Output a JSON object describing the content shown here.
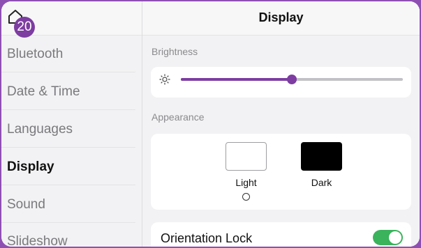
{
  "badge": "20",
  "sidebar": {
    "items": [
      {
        "label": "Bluetooth"
      },
      {
        "label": "Date & Time"
      },
      {
        "label": "Languages"
      },
      {
        "label": "Display"
      },
      {
        "label": "Sound"
      },
      {
        "label": "Slideshow"
      }
    ],
    "selected": "Display"
  },
  "main": {
    "title": "Display",
    "brightness": {
      "label": "Brightness",
      "value": 0.5
    },
    "appearance": {
      "label": "Appearance",
      "options": [
        {
          "label": "Light",
          "selected": false
        },
        {
          "label": "Dark",
          "selected": false
        }
      ]
    },
    "orientation_lock": {
      "label": "Orientation Lock",
      "on": true
    }
  },
  "colors": {
    "accent": "#7d3da1",
    "toggle_on": "#3ab35c"
  },
  "icons": {
    "home": "home-icon",
    "brightness": "sun-icon"
  }
}
